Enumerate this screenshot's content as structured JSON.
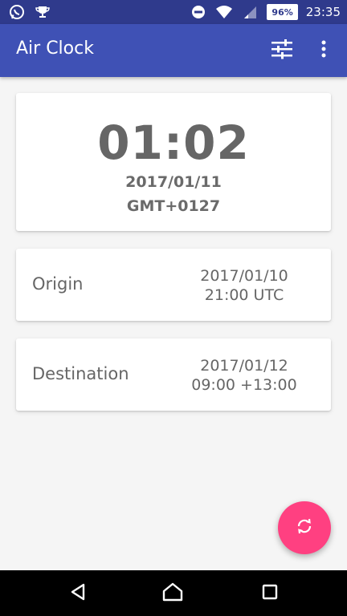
{
  "status_bar": {
    "time": "23:35",
    "battery": "96%"
  },
  "app_bar": {
    "title": "Air Clock"
  },
  "clock_card": {
    "time": "01:02",
    "date": "2017/01/11",
    "timezone": "GMT+0127"
  },
  "origin_card": {
    "label": "Origin",
    "date": "2017/01/10",
    "time": "21:00 UTC"
  },
  "destination_card": {
    "label": "Destination",
    "date": "2017/01/12",
    "time": "09:00 +13:00"
  },
  "colors": {
    "status_bar": "#2f3a8c",
    "app_bar": "#3f51b5",
    "fab": "#ff4081",
    "background": "#f5f5f5"
  }
}
